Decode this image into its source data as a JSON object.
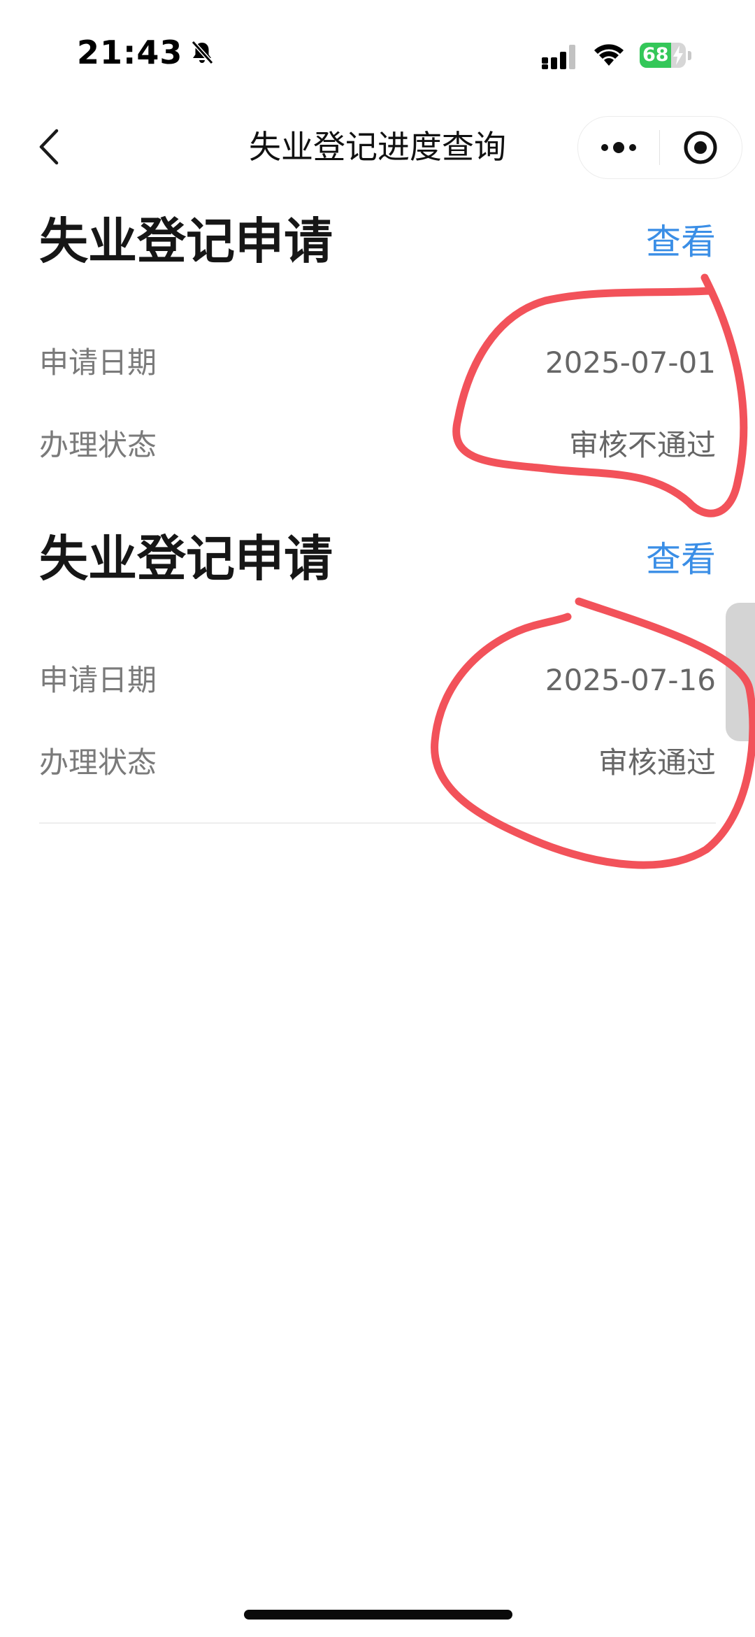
{
  "status_bar": {
    "time": "21:43",
    "battery_level": "68",
    "battery_fraction": 0.68
  },
  "nav": {
    "title": "失业登记进度查询"
  },
  "records": [
    {
      "title": "失业登记申请",
      "view_label": "查看",
      "date_label": "申请日期",
      "date_value": "2025-07-01",
      "status_label": "办理状态",
      "status_value": "审核不通过"
    },
    {
      "title": "失业登记申请",
      "view_label": "查看",
      "date_label": "申请日期",
      "date_value": "2025-07-16",
      "status_label": "办理状态",
      "status_value": "审核通过"
    }
  ],
  "icons": {
    "back": "chevron-left-icon",
    "more": "more-dots-icon",
    "close": "target-circle-icon",
    "silent": "bell-slash-icon",
    "signal": "cellular-signal-icon",
    "wifi": "wifi-icon",
    "charging": "bolt-icon"
  },
  "colors": {
    "link": "#3a8ee6",
    "annotation": "#f2525a",
    "battery": "#34c759"
  }
}
